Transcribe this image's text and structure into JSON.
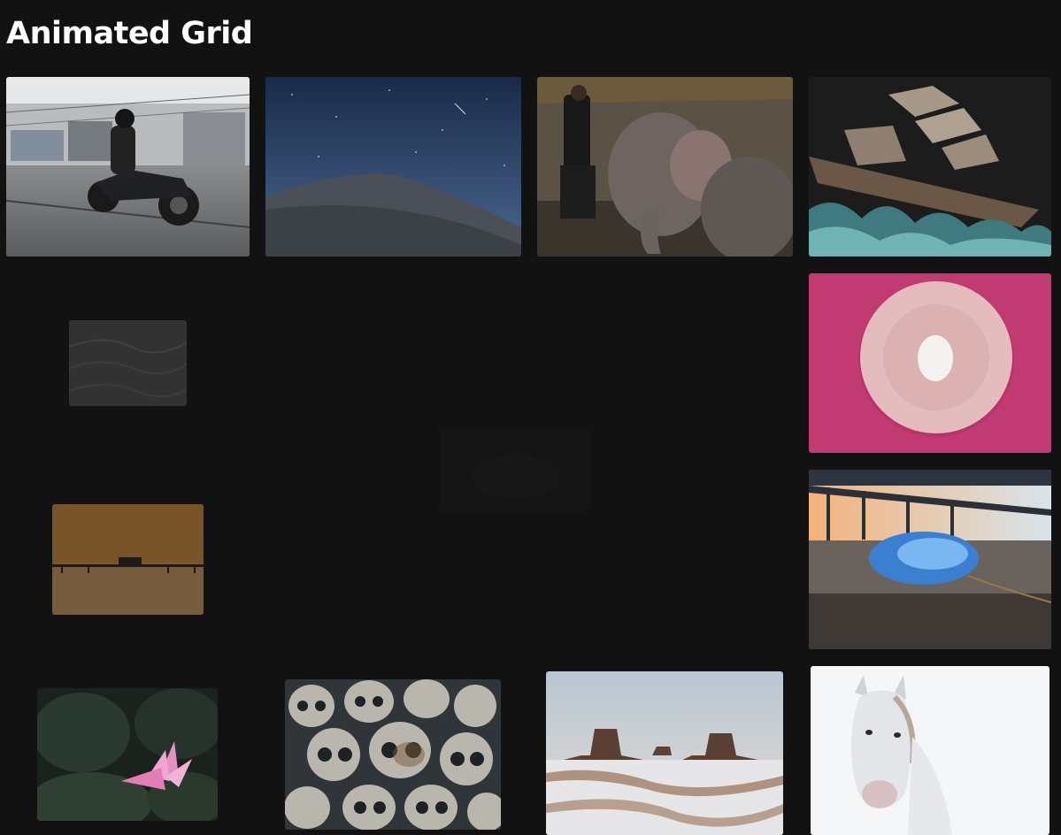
{
  "page": {
    "title": "Animated Grid"
  },
  "grid": {
    "items": [
      {
        "icon": "motorcycle-photo-icon"
      },
      {
        "icon": "night-desert-photo-icon"
      },
      {
        "icon": "elephant-photo-icon"
      },
      {
        "icon": "ship-illustration-icon"
      },
      {
        "icon": "sand-dunes-photo-icon"
      },
      {
        "icon": "faded-dark-photo-icon"
      },
      {
        "icon": "egg-plate-photo-icon"
      },
      {
        "icon": "pier-sunset-photo-icon"
      },
      {
        "icon": "jellyfish-beach-photo-icon"
      },
      {
        "icon": "lotus-photo-icon"
      },
      {
        "icon": "skulls-photo-icon"
      },
      {
        "icon": "monument-valley-photo-icon"
      },
      {
        "icon": "white-horse-photo-icon"
      }
    ]
  },
  "colors": {
    "background": "#121212",
    "title": "#ffffff"
  }
}
